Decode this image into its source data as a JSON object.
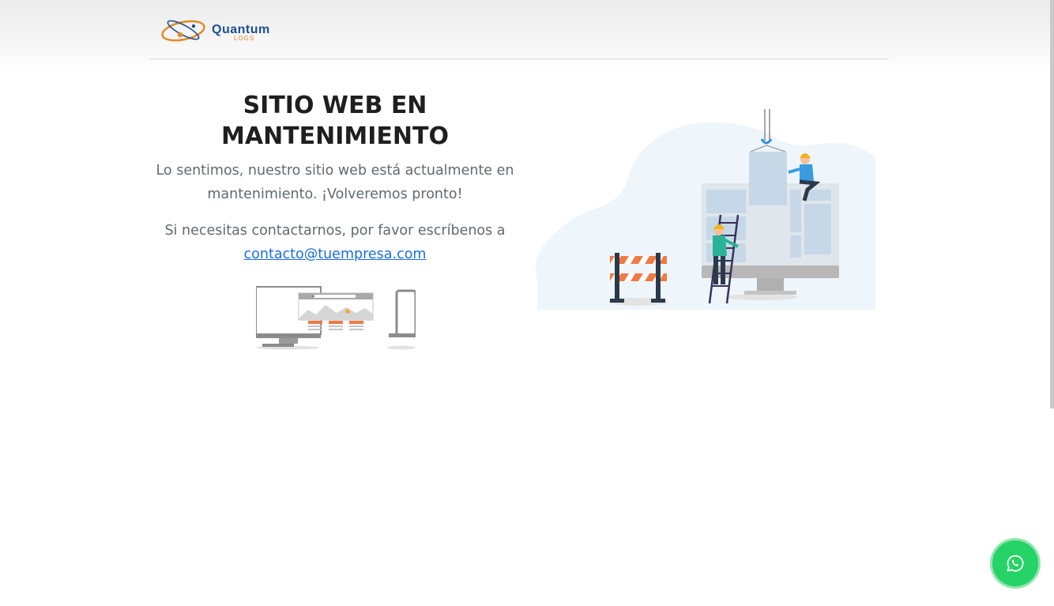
{
  "header": {
    "logo": {
      "wordmark": "Quantum",
      "subtext": "LOGS",
      "icon": "atom-orbit-logo-icon"
    }
  },
  "main": {
    "title_line1": "SITIO WEB EN",
    "title_line2": "MANTENIMIENTO",
    "message": "Lo sentimos, nuestro sitio web está actualmente en mantenimiento. ¡Volveremos pronto!",
    "contact_prefix": "Si necesitas contactarnos, por favor escríbenos a",
    "contact_email": "contacto@tuempresa.com",
    "contact_href": "mailto:contacto@tuempresa.com"
  },
  "floating": {
    "whatsapp_icon": "whatsapp-icon"
  },
  "colors": {
    "link": "#1a6fe0",
    "whatsapp": "#25d366",
    "accent_orange": "#f07a45",
    "brand_blue": "#1c4f8f"
  }
}
